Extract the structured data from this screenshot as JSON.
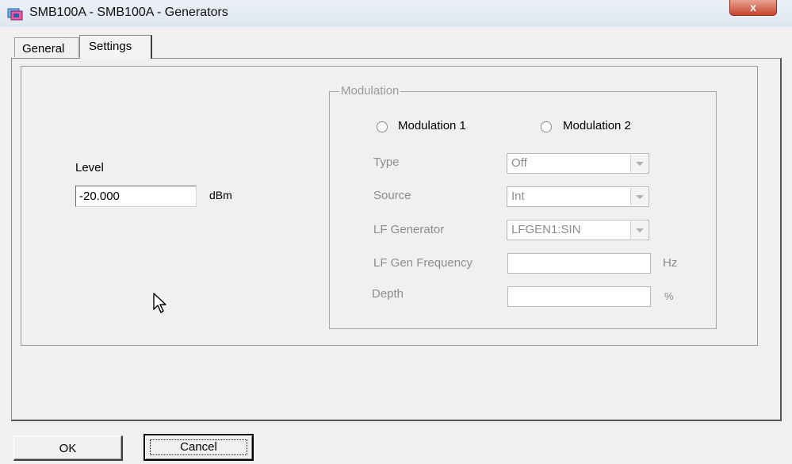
{
  "window": {
    "title": "SMB100A - SMB100A - Generators",
    "close_glyph": "x"
  },
  "tabs": [
    {
      "label": "General"
    },
    {
      "label": "Settings"
    }
  ],
  "level": {
    "label": "Level",
    "value": "-20.000",
    "unit": "dBm"
  },
  "modulation": {
    "group_label": "Modulation",
    "options": [
      {
        "label": "Modulation 1"
      },
      {
        "label": "Modulation 2"
      }
    ],
    "type": {
      "label": "Type",
      "value": "Off"
    },
    "source": {
      "label": "Source",
      "value": "Int"
    },
    "lf_generator": {
      "label": "LF Generator",
      "value": "LFGEN1:SIN"
    },
    "lf_gen_frequency": {
      "label": "LF Gen Frequency",
      "value": "",
      "unit": "Hz"
    },
    "depth": {
      "label": "Depth",
      "value": "",
      "unit": "%"
    }
  },
  "buttons": {
    "ok": "OK",
    "cancel": "Cancel"
  },
  "colors": {
    "titlebar": "#dde6f0",
    "close": "#c8442f",
    "disabled_text": "#8c8c8c"
  }
}
